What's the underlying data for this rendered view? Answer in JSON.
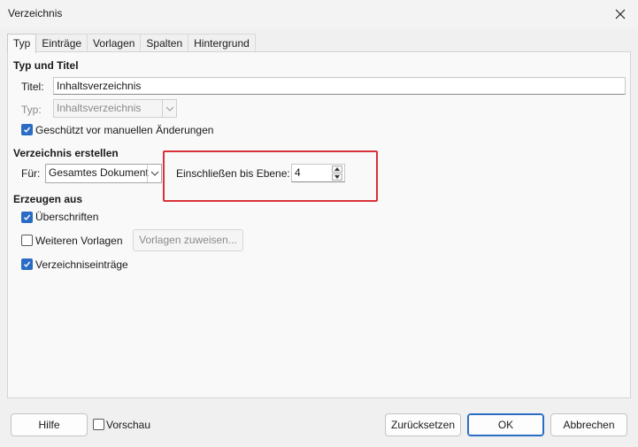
{
  "window": {
    "title": "Verzeichnis"
  },
  "tabs": [
    {
      "label": "Typ"
    },
    {
      "label": "Einträge"
    },
    {
      "label": "Vorlagen"
    },
    {
      "label": "Spalten"
    },
    {
      "label": "Hintergrund"
    }
  ],
  "type_section": {
    "heading": "Typ und Titel",
    "title_label": "Titel:",
    "title_value": "Inhaltsverzeichnis",
    "type_label": "Typ:",
    "type_value": "Inhaltsverzeichnis",
    "protected_label": "Geschützt vor manuellen Änderungen",
    "protected_checked": true
  },
  "create_section": {
    "heading": "Verzeichnis erstellen",
    "for_label": "Für:",
    "for_value": "Gesamtes Dokument",
    "level_label": "Einschließen bis Ebene:",
    "level_value": "4"
  },
  "generate_section": {
    "heading": "Erzeugen aus",
    "headings_label": "Überschriften",
    "headings_checked": true,
    "more_styles_label": "Weiteren Vorlagen",
    "more_styles_checked": false,
    "assign_styles_label": "Vorlagen zuweisen...",
    "index_entries_label": "Verzeichniseinträge",
    "index_entries_checked": true
  },
  "footer": {
    "help_label": "Hilfe",
    "preview_label": "Vorschau",
    "preview_checked": false,
    "reset_label": "Zurücksetzen",
    "ok_label": "OK",
    "cancel_label": "Abbrechen"
  },
  "colors": {
    "accent": "#2a6cc4",
    "highlight": "#d9323a"
  }
}
